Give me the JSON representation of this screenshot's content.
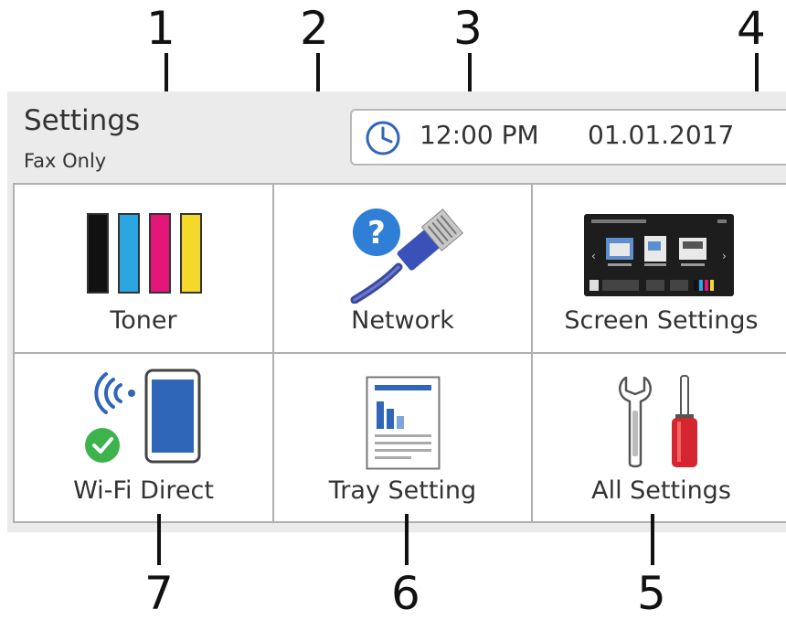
{
  "header": {
    "title": "Settings",
    "subtitle": "Fax Only",
    "time": "12:00 PM",
    "date": "01.01.2017",
    "clock_icon": "clock-icon"
  },
  "tiles": [
    {
      "label": "Toner",
      "icon": "toner-icon"
    },
    {
      "label": "Network",
      "icon": "network-help-icon"
    },
    {
      "label": "Screen Settings",
      "icon": "screen-settings-icon"
    },
    {
      "label": "Wi-Fi Direct",
      "icon": "wifi-direct-icon"
    },
    {
      "label": "Tray Setting",
      "icon": "tray-setting-icon"
    },
    {
      "label": "All Settings",
      "icon": "all-settings-icon"
    }
  ],
  "callouts": [
    "1",
    "2",
    "3",
    "4",
    "5",
    "6",
    "7"
  ],
  "colors": {
    "toner_black": "#111111",
    "toner_cyan": "#2ca6e0",
    "toner_magenta": "#e4167a",
    "toner_yellow": "#f4d92a",
    "check_green": "#3cb44b",
    "screwdriver_red": "#d42531",
    "accent_blue": "#2f66b8"
  }
}
